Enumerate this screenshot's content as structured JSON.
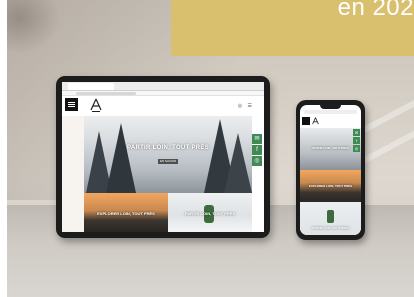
{
  "banner": {
    "text": "en 202"
  },
  "site": {
    "hero_title": "PARTIR LOIN, TOUT PRÈS",
    "hero_button": "EN SAVOIR",
    "card_left_title": "EXPLORER LOIN, TOUT PRÈS",
    "card_right_title": "PARTIR LOIN, TOUT PRÈS",
    "header_icons": "◎ ☰",
    "social": [
      "✉",
      "f",
      "◎"
    ]
  },
  "phone": {
    "hero_title": "PARTIR LOIN, TOUT PRÈS",
    "card1_title": "EXPLORER LOIN, TOUT PRÈS",
    "card2_title": "PARTIR LOIN, TOUT PRÈS",
    "social": [
      "✉",
      "f",
      "◎"
    ]
  },
  "colors": {
    "banner": "#d8c06f",
    "social_green": "#3f8a55",
    "device_frame": "#1c1c1c"
  }
}
